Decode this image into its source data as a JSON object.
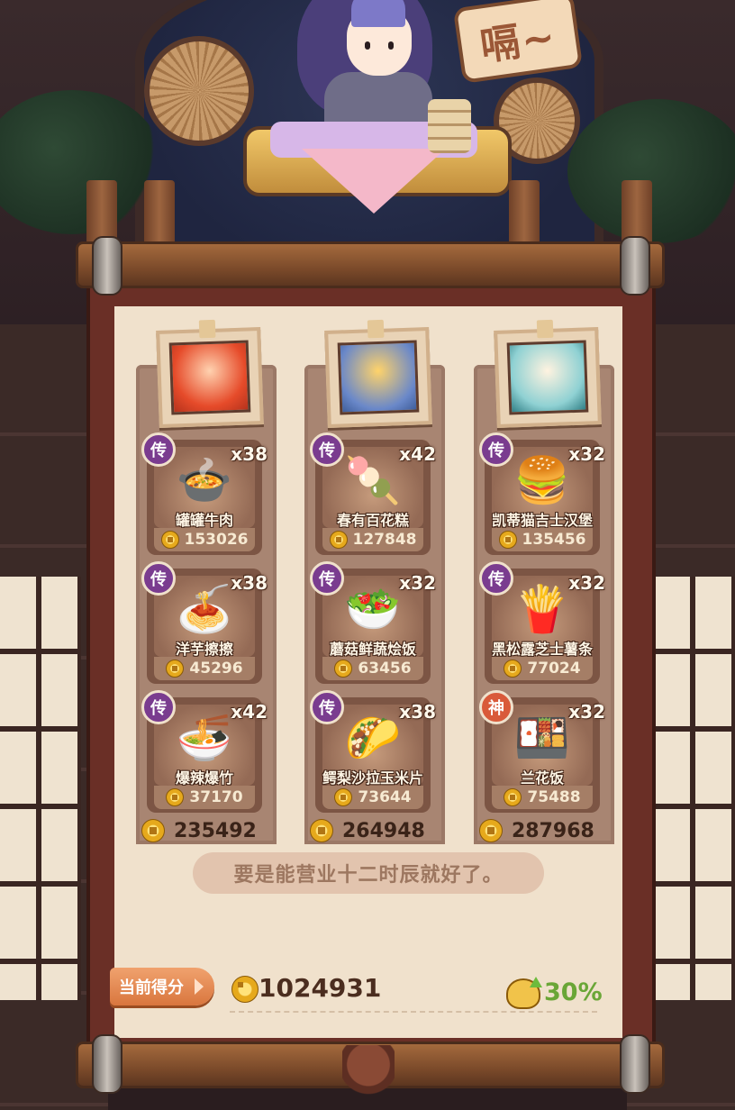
{
  "speech": "嗝~",
  "columns": [
    {
      "portrait": "fire",
      "dishes": [
        {
          "badge": "传",
          "count": "x38",
          "name": "罐罐牛肉",
          "price": "153026",
          "emoji": "🍲"
        },
        {
          "badge": "传",
          "count": "x38",
          "name": "洋芋擦擦",
          "price": "45296",
          "emoji": "🍝"
        },
        {
          "badge": "传",
          "count": "x42",
          "name": "爆辣爆竹",
          "price": "37170",
          "emoji": "🍜"
        }
      ],
      "total": "235492"
    },
    {
      "portrait": "bear",
      "dishes": [
        {
          "badge": "传",
          "count": "x42",
          "name": "春有百花糕",
          "price": "127848",
          "emoji": "🍡"
        },
        {
          "badge": "传",
          "count": "x32",
          "name": "蘑菇鲜蔬烩饭",
          "price": "63456",
          "emoji": "🥗"
        },
        {
          "badge": "传",
          "count": "x38",
          "name": "鳄梨沙拉玉米片",
          "price": "73644",
          "emoji": "🌮"
        }
      ],
      "total": "264948"
    },
    {
      "portrait": "fairy",
      "dishes": [
        {
          "badge": "传",
          "count": "x32",
          "name": "凯蒂猫吉士汉堡",
          "price": "135456",
          "emoji": "🍔"
        },
        {
          "badge": "传",
          "count": "x32",
          "name": "黑松露芝士薯条",
          "price": "77024",
          "emoji": "🍟"
        },
        {
          "badge": "神",
          "count": "x32",
          "name": "兰花饭",
          "price": "75488",
          "emoji": "🍱"
        }
      ],
      "total": "287968"
    }
  ],
  "quote": "要是能营业十二时辰就好了。",
  "score": {
    "label": "当前得分",
    "value": "1024931"
  },
  "bonus": "30%"
}
